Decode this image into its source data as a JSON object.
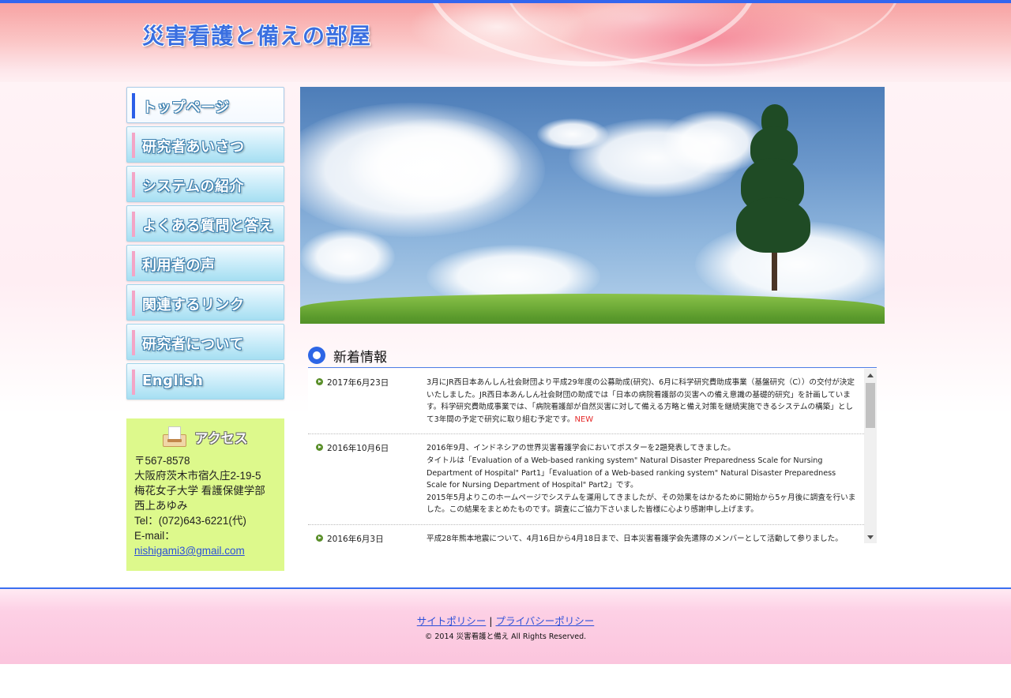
{
  "header": {
    "site_title": "災害看護と備えの部屋"
  },
  "nav": {
    "items": [
      {
        "label": "トップページ",
        "active": true
      },
      {
        "label": "研究者あいさつ",
        "active": false
      },
      {
        "label": "システムの紹介",
        "active": false
      },
      {
        "label": "よくある質問と答え",
        "active": false
      },
      {
        "label": "利用者の声",
        "active": false
      },
      {
        "label": "関連するリンク",
        "active": false
      },
      {
        "label": "研究者について",
        "active": false
      },
      {
        "label": "English",
        "active": false
      }
    ]
  },
  "access": {
    "title": "アクセス",
    "postal": "〒567-8578",
    "address": "大阪府茨木市宿久庄2-19-5",
    "institution": "梅花女子大学 看護保健学部",
    "person": "西上あゆみ",
    "tel": "Tel：(072)643-6221(代)",
    "email_label": "E-mail：",
    "email": "nishigami3@gmail.com"
  },
  "news": {
    "heading": "新着情報",
    "items": [
      {
        "date": "2017年6月23日",
        "paragraphs": [
          "3月にJR西日本あんしん社会財団より平成29年度の公募助成(研究)、6月に科学研究費助成事業（基盤研究（C））の交付が決定いたしました。JR西日本あんしん社会財団の助成では「日本の病院看護部の災害への備え意識の基礎的研究」を計画しています。科学研究費助成事業では、「病院看護部が自然災害に対して備える方略と備え対策を継続実施できるシステムの構築」として3年間の予定で研究に取り組む予定です。"
        ],
        "badge": "NEW"
      },
      {
        "date": "2016年10月6日",
        "paragraphs": [
          "2016年9月、インドネシアの世界災害看護学会においてポスターを2題発表してきました。",
          "タイトルは「Evaluation of a Web-based ranking system\" Natural Disaster Preparedness Scale for Nursing Department of Hospital\" Part1」「Evaluation of a Web-based ranking system\" Natural Disaster Preparedness Scale for Nursing Department of Hospital\" Part2」です。",
          "2015年5月よりこのホームページでシステムを運用してきましたが、その効果をはかるために開始から5ヶ月後に調査を行いました。この結果をまとめたものです。調査にご協力下さいました皆様に心より感謝申し上げます。"
        ],
        "badge": ""
      },
      {
        "date": "2016年6月3日",
        "paragraphs": [
          "平成28年熊本地震について、4月16日から4月18日まで、日本災害看護学会先遣隊のメンバーとして活動して参りました。"
        ],
        "badge": ""
      }
    ]
  },
  "footer": {
    "site_policy": "サイトポリシー",
    "separator": "|",
    "privacy_policy": "プライバシーポリシー",
    "copyright": "© 2014 災害看護と備え All Rights Reserved."
  },
  "colors": {
    "accent": "#3366ee",
    "access_bg": "#ddf98c",
    "new_badge": "#e52b2b"
  }
}
